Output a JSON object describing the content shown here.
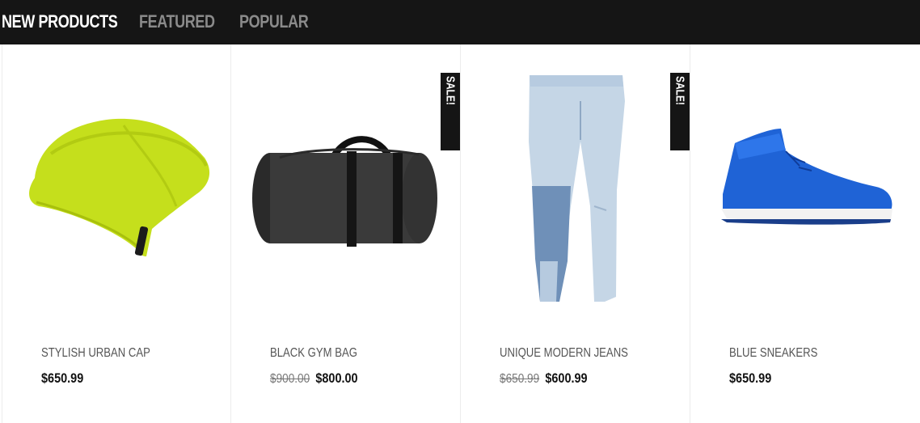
{
  "tabs": [
    {
      "label": "NEW PRODUCTS",
      "active": true
    },
    {
      "label": "FEATURED",
      "active": false
    },
    {
      "label": "POPULAR",
      "active": false
    }
  ],
  "products": [
    {
      "name": "STYLISH URBAN CAP",
      "old_price": "",
      "price": "$650.99",
      "sale": false,
      "image": "lime-beanie",
      "color": "#c9e21f"
    },
    {
      "name": "BLACK GYM BAG",
      "old_price": "$900.00",
      "price": "$800.00",
      "sale": true,
      "sale_label": "SALE!",
      "image": "black-duffel-bag",
      "color": "#2e2e2e"
    },
    {
      "name": "UNIQUE MODERN JEANS",
      "old_price": "$650.99",
      "price": "$600.99",
      "sale": true,
      "sale_label": "SALE!",
      "image": "light-blue-jeans",
      "color": "#a9c1d9"
    },
    {
      "name": "BLUE SNEAKERS",
      "old_price": "",
      "price": "$650.99",
      "sale": false,
      "image": "blue-high-top-sneaker",
      "color": "#1e5fcf"
    }
  ],
  "colors": {
    "tabbar_bg": "#151515",
    "tab_active": "#ffffff",
    "tab_inactive": "#8a8a8a"
  }
}
